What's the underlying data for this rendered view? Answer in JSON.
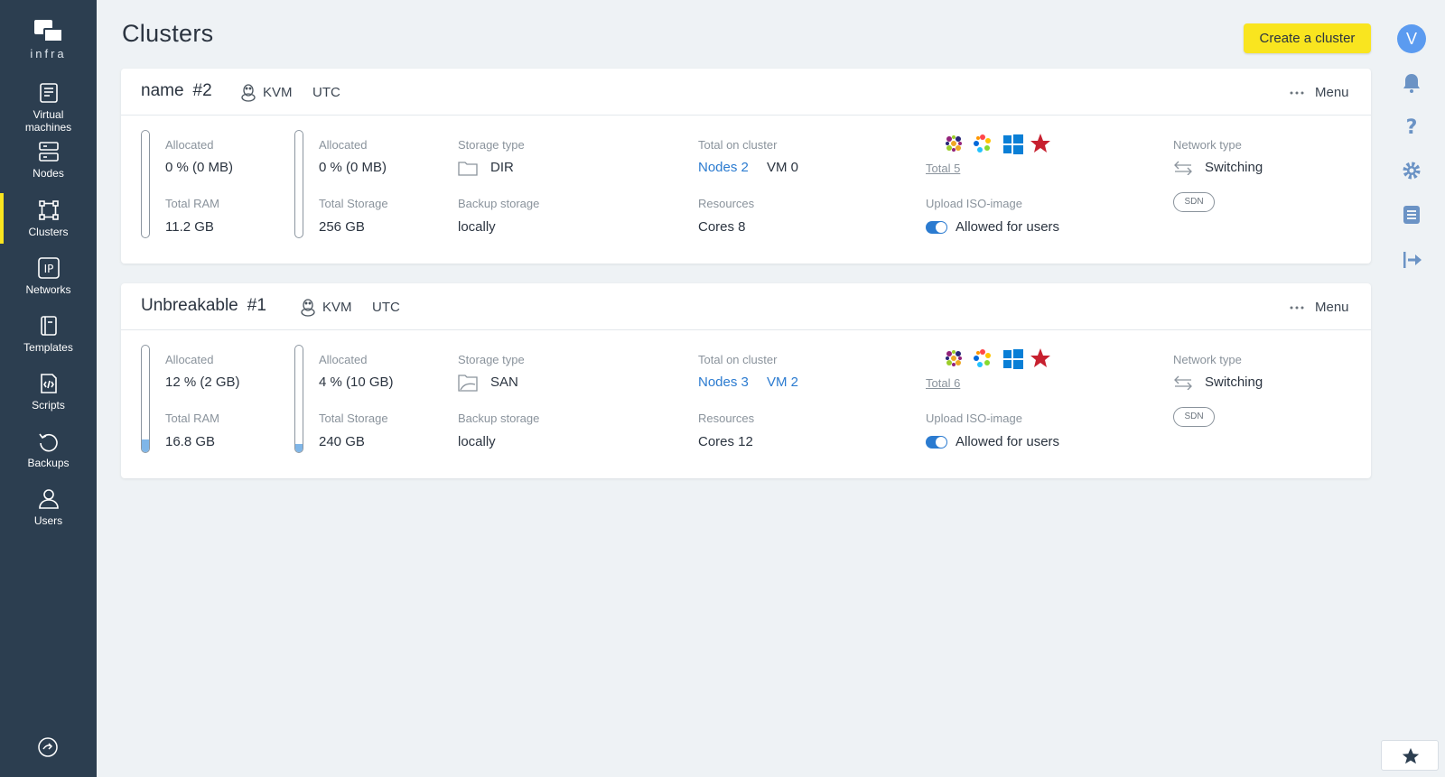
{
  "sidebar": {
    "logo_text": "infra",
    "items": [
      {
        "label": "Virtual machines",
        "icon": "vm-icon"
      },
      {
        "label": "Nodes",
        "icon": "nodes-icon"
      },
      {
        "label": "Clusters",
        "icon": "clusters-icon"
      },
      {
        "label": "Networks",
        "icon": "networks-icon"
      },
      {
        "label": "Templates",
        "icon": "templates-icon"
      },
      {
        "label": "Scripts",
        "icon": "scripts-icon"
      },
      {
        "label": "Backups",
        "icon": "backups-icon"
      },
      {
        "label": "Users",
        "icon": "users-icon"
      }
    ],
    "active": "Clusters",
    "active_color": "#f9e51f"
  },
  "header": {
    "title": "Clusters",
    "create_button": "Create a cluster",
    "accent": "#f9e51f"
  },
  "rail": {
    "avatar_initial": "V",
    "avatar_color": "#5b9bf0"
  },
  "clusters": [
    {
      "name": "name",
      "number": "#2",
      "hypervisor": "KVM",
      "timezone": "UTC",
      "menu_label": "Menu",
      "ram": {
        "allocated_label": "Allocated",
        "allocated_value": "0 % (0 MB)",
        "total_label": "Total RAM",
        "total_value": "11.2 GB",
        "fill_fraction": 0.0
      },
      "storage": {
        "allocated_label": "Allocated",
        "allocated_value": "0 % (0 MB)",
        "total_label": "Total Storage",
        "total_value": "256 GB",
        "fill_fraction": 0.0
      },
      "storage_type": {
        "label": "Storage type",
        "value": "DIR",
        "icon": "folder-icon"
      },
      "backup": {
        "label": "Backup storage",
        "value": "locally"
      },
      "total_on_cluster": {
        "label": "Total on cluster",
        "nodes": "Nodes 2",
        "vm": "VM 0"
      },
      "resources": {
        "label": "Resources",
        "value": "Cores 8"
      },
      "os_total": "Total 5",
      "upload_iso": {
        "label": "Upload ISO-image",
        "value": "Allowed for users"
      },
      "network": {
        "label": "Network type",
        "value": "Switching",
        "badge": "SDN"
      }
    },
    {
      "name": "Unbreakable",
      "number": "#1",
      "hypervisor": "KVM",
      "timezone": "UTC",
      "menu_label": "Menu",
      "ram": {
        "allocated_label": "Allocated",
        "allocated_value": "12 % (2 GB)",
        "total_label": "Total RAM",
        "total_value": "16.8 GB",
        "fill_fraction": 0.12
      },
      "storage": {
        "allocated_label": "Allocated",
        "allocated_value": "4 % (10 GB)",
        "total_label": "Total Storage",
        "total_value": "240 GB",
        "fill_fraction": 0.04
      },
      "storage_type": {
        "label": "Storage type",
        "value": "SAN",
        "icon": "san-icon"
      },
      "backup": {
        "label": "Backup storage",
        "value": "locally"
      },
      "total_on_cluster": {
        "label": "Total on cluster",
        "nodes": "Nodes 3",
        "vm": "VM 2"
      },
      "resources": {
        "label": "Resources",
        "value": "Cores 12"
      },
      "os_total": "Total 6",
      "upload_iso": {
        "label": "Upload ISO-image",
        "value": "Allowed for users"
      },
      "network": {
        "label": "Network type",
        "value": "Switching",
        "badge": "SDN"
      }
    }
  ],
  "colors": {
    "sidebar_bg": "#2c3e50",
    "link": "#2b7bd0",
    "page_bg": "#eef2f5"
  }
}
